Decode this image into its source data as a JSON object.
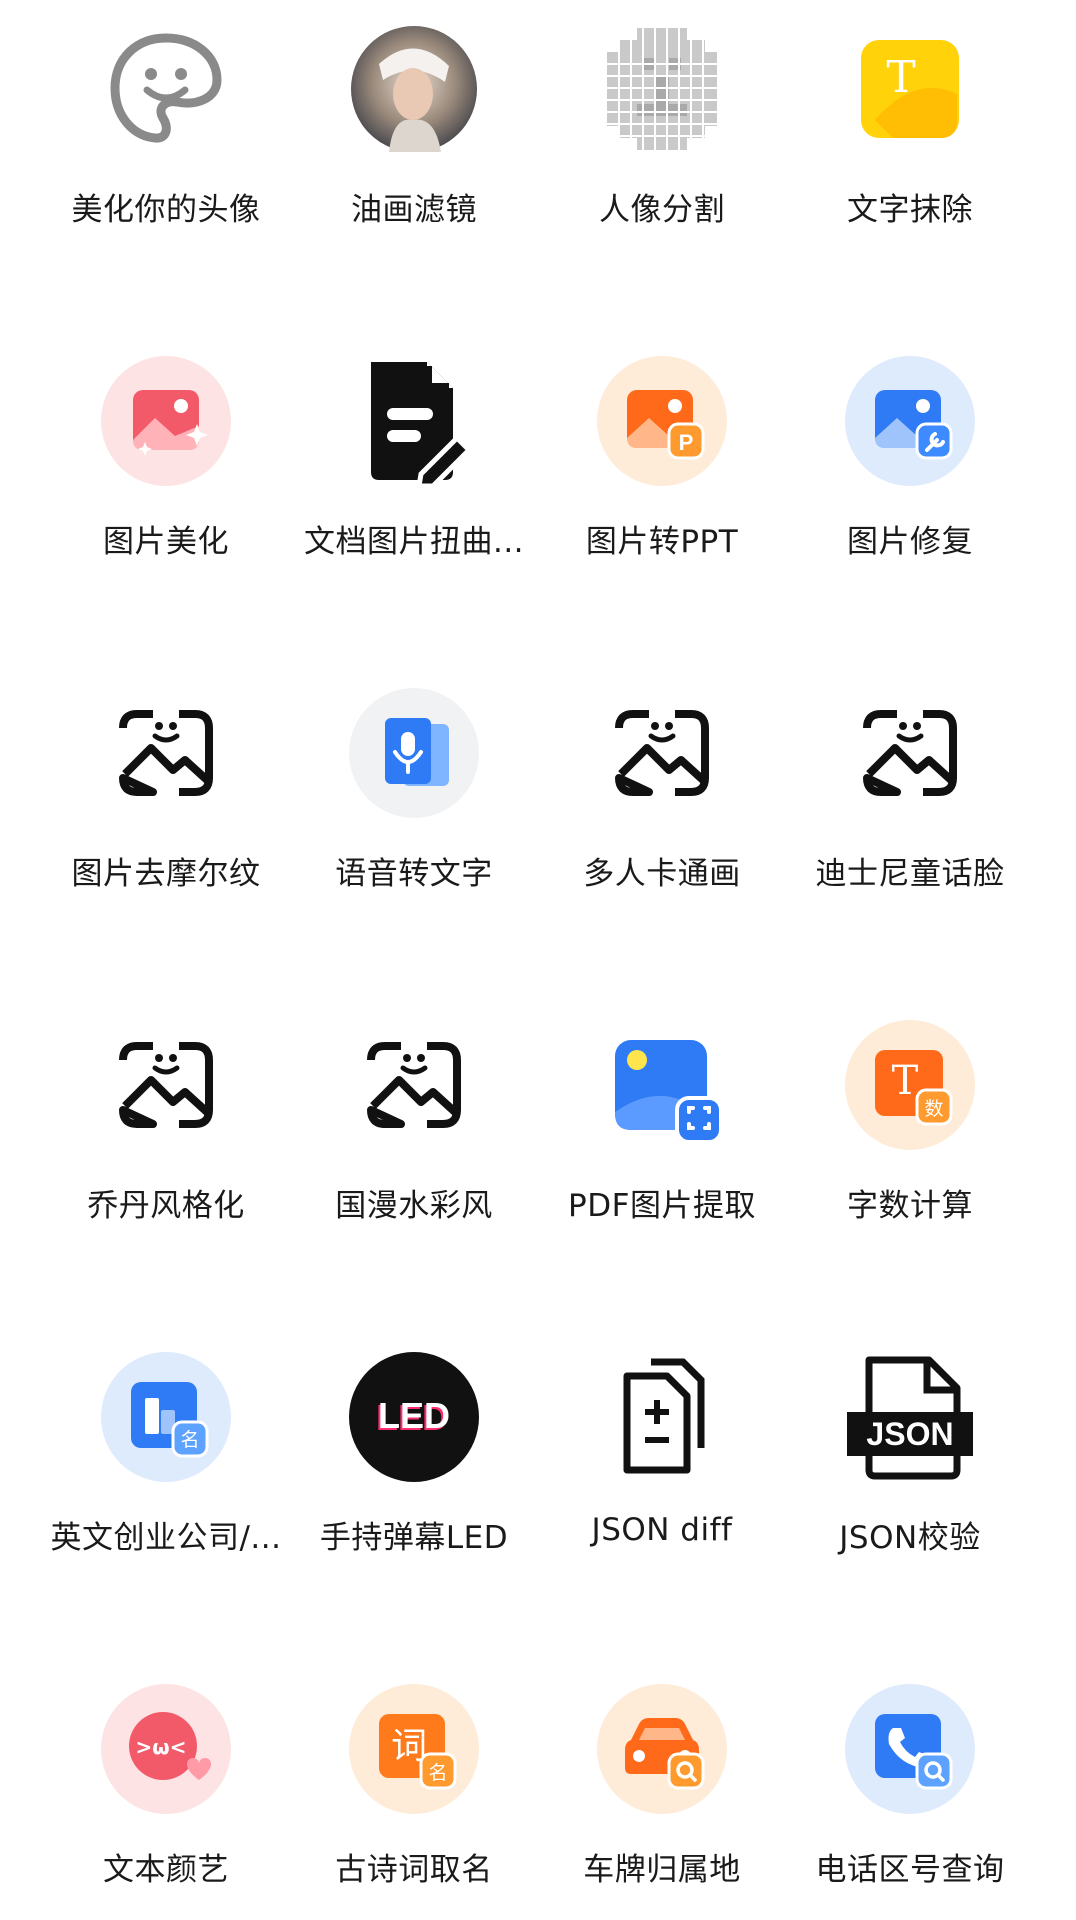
{
  "tools": [
    {
      "label": "美化你的头像",
      "icon": "smiley-face-icon"
    },
    {
      "label": "油画滤镜",
      "icon": "oil-painting-portrait-icon"
    },
    {
      "label": "人像分割",
      "icon": "pixelated-portrait-icon"
    },
    {
      "label": "文字抹除",
      "icon": "text-erase-icon"
    },
    {
      "label": "图片美化",
      "icon": "image-beautify-icon"
    },
    {
      "label": "文档图片扭曲...",
      "icon": "document-edit-icon"
    },
    {
      "label": "图片转PPT",
      "icon": "image-to-ppt-icon"
    },
    {
      "label": "图片修复",
      "icon": "image-repair-icon"
    },
    {
      "label": "图片去摩尔纹",
      "icon": "image-smile-icon"
    },
    {
      "label": "语音转文字",
      "icon": "voice-to-text-icon"
    },
    {
      "label": "多人卡通画",
      "icon": "image-smile-icon"
    },
    {
      "label": "迪士尼童话脸",
      "icon": "image-smile-icon"
    },
    {
      "label": "乔丹风格化",
      "icon": "image-smile-icon"
    },
    {
      "label": "国漫水彩风",
      "icon": "image-smile-icon"
    },
    {
      "label": "PDF图片提取",
      "icon": "pdf-image-extract-icon"
    },
    {
      "label": "字数计算",
      "icon": "word-count-icon"
    },
    {
      "label": "英文创业公司/...",
      "icon": "company-name-icon"
    },
    {
      "label": "手持弹幕LED",
      "icon": "led-icon"
    },
    {
      "label": "JSON diff",
      "icon": "file-diff-icon"
    },
    {
      "label": "JSON校验",
      "icon": "json-file-icon"
    },
    {
      "label": "文本颜艺",
      "icon": "kaomoji-icon"
    },
    {
      "label": "古诗词取名",
      "icon": "poem-name-icon"
    },
    {
      "label": "车牌归属地",
      "icon": "car-plate-search-icon"
    },
    {
      "label": "电话区号查询",
      "icon": "phone-search-icon"
    }
  ],
  "icon_badges": {
    "ppt": "P",
    "word_count_main": "T",
    "word_count_badge": "数",
    "text_erase": "T",
    "company_badge": "名",
    "led": "LED",
    "json": "JSON",
    "poem_main": "词",
    "poem_badge": "名",
    "kaomoji": ">ω<"
  },
  "colors": {
    "label": "#1a1a1a",
    "blue": "#2f7bf5",
    "orange": "#ff7a1a",
    "pink": "#f25a6a",
    "yellow": "#ffd20a"
  }
}
